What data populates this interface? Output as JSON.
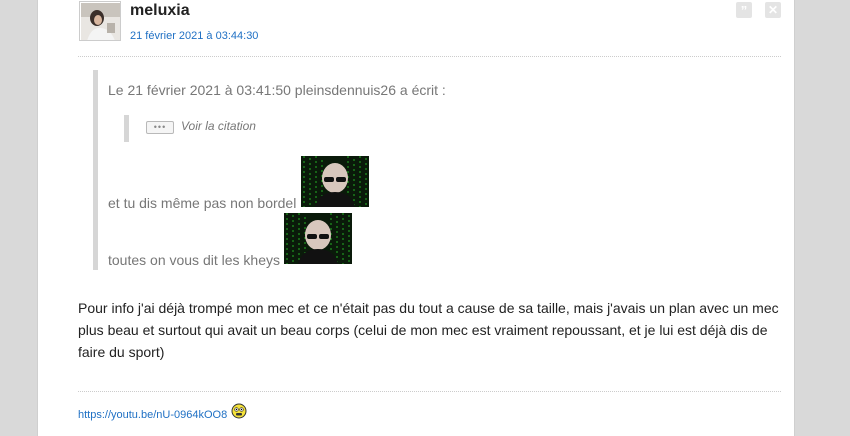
{
  "post": {
    "username": "meluxia",
    "date": "21 février 2021 à 03:44:30",
    "quote_button": "”",
    "delete_button": "✕",
    "quote": {
      "header": "Le 21 février 2021 à 03:41:50 pleinsdennuis26 a écrit :",
      "ellipsis": "•••",
      "voir_citation": "Voir la citation",
      "line1": "et tu dis même pas non bordel",
      "line2": "toutes on vous dit les kheys"
    },
    "body": "Pour info j'ai déjà trompé mon mec et ce n'était pas du tout a cause de sa taille, mais j'avais un plan avec un mec plus beau et surtout qui avait un beau corps (celui de mon mec est vraiment repoussant, et je lui est déjà dis de faire du sport)",
    "signature_link": "https://youtu.be/nU-0964kOO8"
  },
  "colors": {
    "link": "#1f70c4",
    "quote_text": "#777777",
    "matrix_green": "#2bd12b"
  },
  "icons": {
    "quote": "quote-icon",
    "delete": "close-icon",
    "smiley": "smiley-icon"
  }
}
